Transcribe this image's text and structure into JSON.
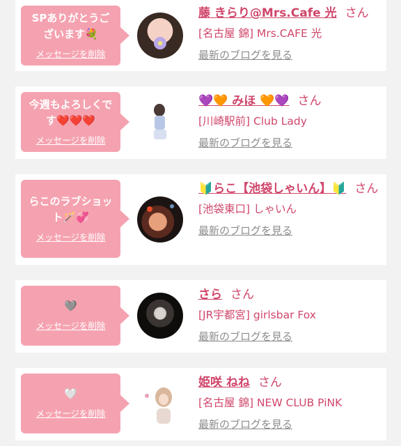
{
  "cards": [
    {
      "message": "SPありがとうございます💐",
      "delete_label": "メッセージを削除",
      "name": "藤 きらり@Mrs.Cafe 光",
      "honorific": "さん",
      "shop": "[名古屋 錦] Mrs.CAFE 光",
      "blog_label": "最新のブログを見る"
    },
    {
      "message": "今週もよろしくです❤️❤️❤️",
      "delete_label": "メッセージを削除",
      "name": "💜🧡 みほ 🧡💜",
      "honorific": "さん",
      "shop": "[川崎駅前] Club Lady",
      "blog_label": "最新のブログを見る"
    },
    {
      "message": "らこのラブショット🪄💞",
      "delete_label": "メッセージを削除",
      "name": "🔰らこ【池袋しゃいん】🔰",
      "honorific": "さん",
      "shop": "[池袋東口] しゃいん",
      "blog_label": "最新のブログを見る"
    },
    {
      "message": "🩶",
      "delete_label": "メッセージを削除",
      "name": "さら",
      "honorific": "さん",
      "shop": "[JR宇都宮] girlsbar Fox",
      "blog_label": "最新のブログを見る"
    },
    {
      "message": "🤍",
      "delete_label": "メッセージを削除",
      "name": "姫咲 ねね",
      "honorific": "さん",
      "shop": "[名古屋 錦] NEW CLUB PiNK",
      "blog_label": "最新のブログを見る"
    }
  ],
  "colors": {
    "accent": "#d0466a",
    "bubble": "#f5a2b0",
    "muted": "#8c8c8c",
    "background": "#f2f2f2"
  }
}
